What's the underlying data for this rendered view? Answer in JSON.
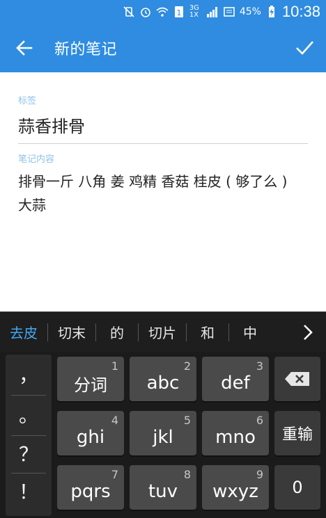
{
  "status_bar": {
    "battery": "45%",
    "time": "10:38",
    "network": "3G 1X"
  },
  "app_bar": {
    "title": "新的笔记"
  },
  "form": {
    "tag_label": "标签",
    "tag_value": "蒜香排骨",
    "content_label": "笔记内容",
    "content_value": "排骨一斤 八角 姜 鸡精 香菇 桂皮 ( 够了么 )\n大蒜"
  },
  "candidates": [
    "去皮",
    "切末",
    "的",
    "切片",
    "和",
    "中"
  ],
  "keyboard": {
    "symbols": [
      "，",
      "。",
      "？",
      "！"
    ],
    "keys": [
      {
        "num": "1",
        "label": "分词"
      },
      {
        "num": "2",
        "label": "abc"
      },
      {
        "num": "3",
        "label": "def"
      },
      {
        "num": "4",
        "label": "ghi"
      },
      {
        "num": "5",
        "label": "jkl"
      },
      {
        "num": "6",
        "label": "mno"
      },
      {
        "num": "7",
        "label": "pqrs"
      },
      {
        "num": "8",
        "label": "tuv"
      },
      {
        "num": "9",
        "label": "wxyz"
      }
    ],
    "reenter_label": "重输",
    "zero_label": "0"
  }
}
